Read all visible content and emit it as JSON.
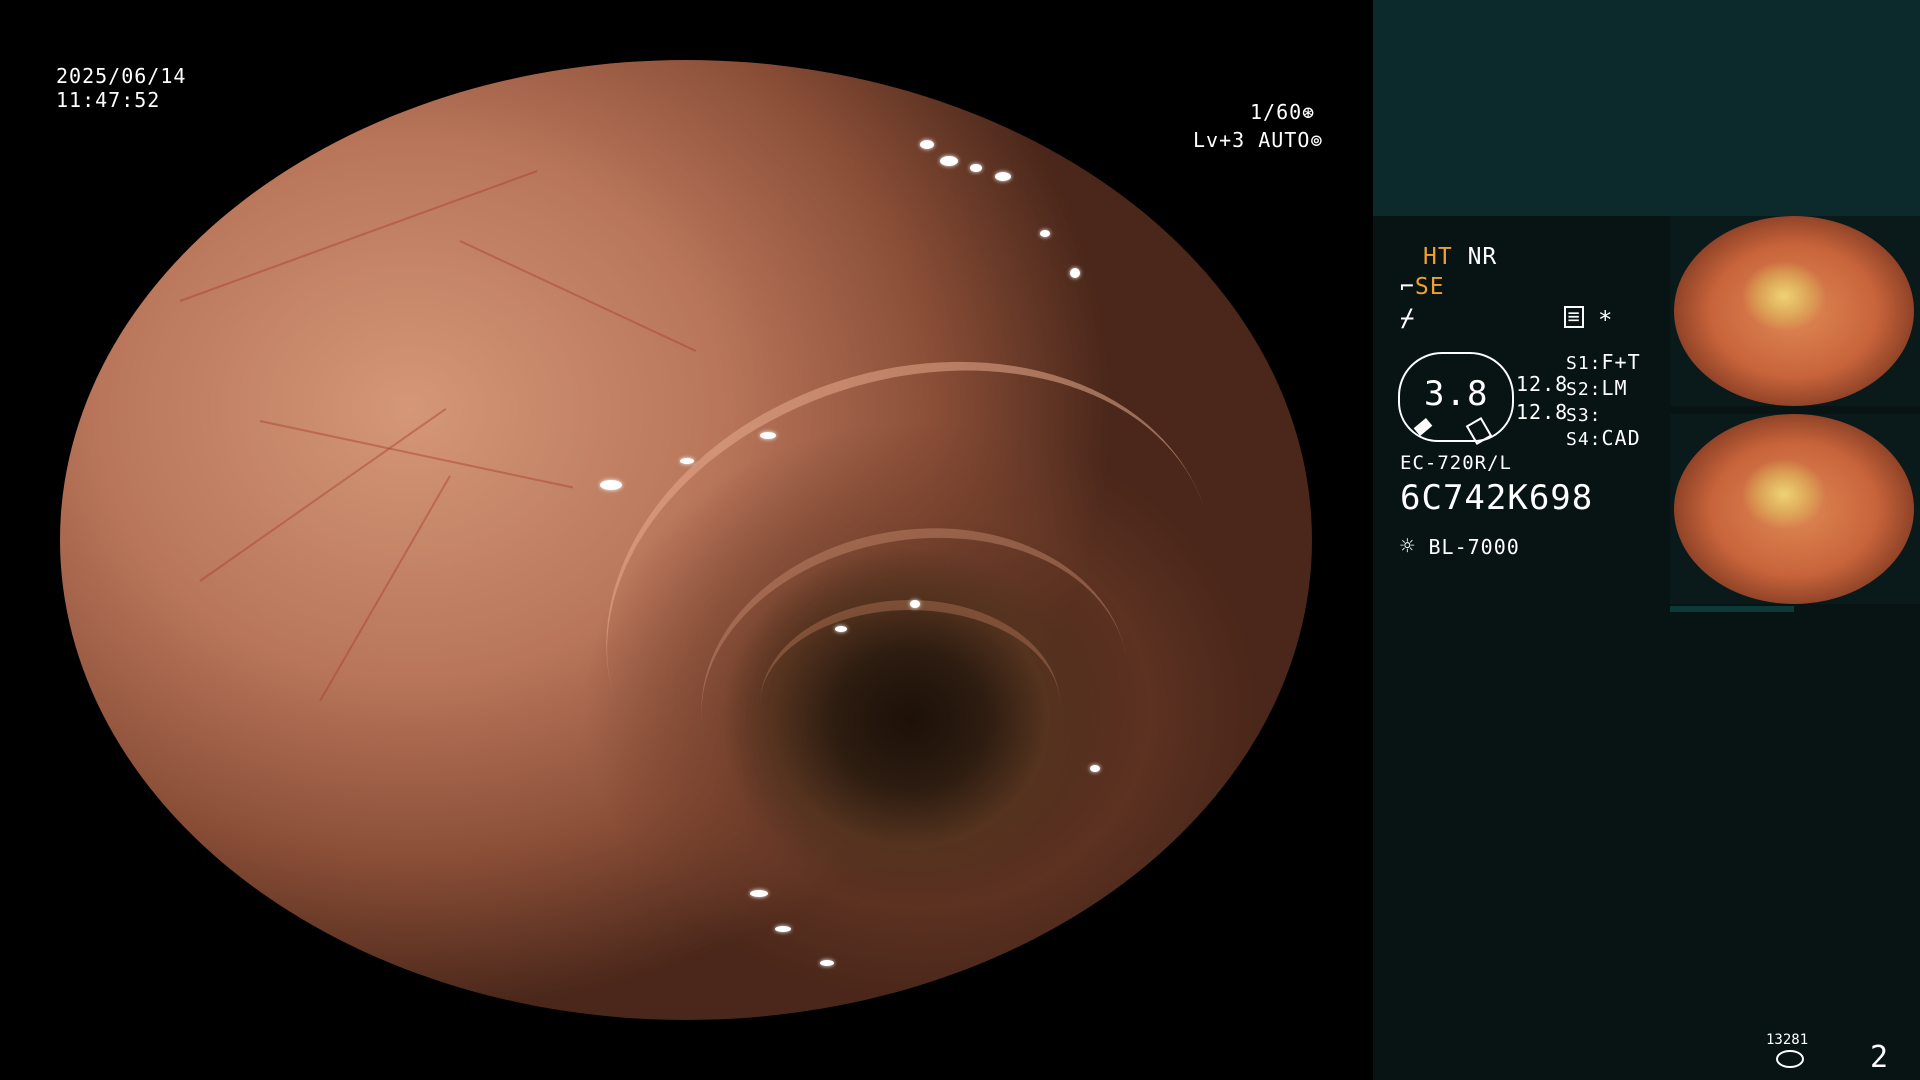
{
  "overlay": {
    "date": "2025/06/14",
    "time": "11:47:52",
    "shutter": "1/60",
    "shutter_icon": "aperture-icon",
    "level": "Lv+3",
    "iris_mode": "AUTO",
    "iris_icon": "iris-icon"
  },
  "settings": {
    "ht": "HT",
    "nr": "NR",
    "se": "SE",
    "se_icon": "scope-icon",
    "f_icon": "freeze-icon",
    "menu_icon": "menu-icon",
    "asterisk": "*",
    "gauge_value": "3.8",
    "side_value_1": "12.8",
    "side_value_2": "12.8",
    "s1_label": "S1:",
    "s1_value": "F+T",
    "s2_label": "S2:",
    "s2_value": "LM",
    "s3_label": "S3:",
    "s3_value": "",
    "s4_label": "S4:",
    "s4_value": "CAD"
  },
  "device": {
    "scope_model": "EC-720R/L",
    "serial": "6C742K698",
    "light_source": "BL-7000",
    "light_icon": "light-source-icon"
  },
  "footer": {
    "counter": "13281",
    "counter_icon": "disk-icon",
    "page": "2"
  },
  "colors": {
    "accent_orange": "#f0a030",
    "panel_top": "#0c2a2b",
    "panel_bottom": "#081414"
  }
}
